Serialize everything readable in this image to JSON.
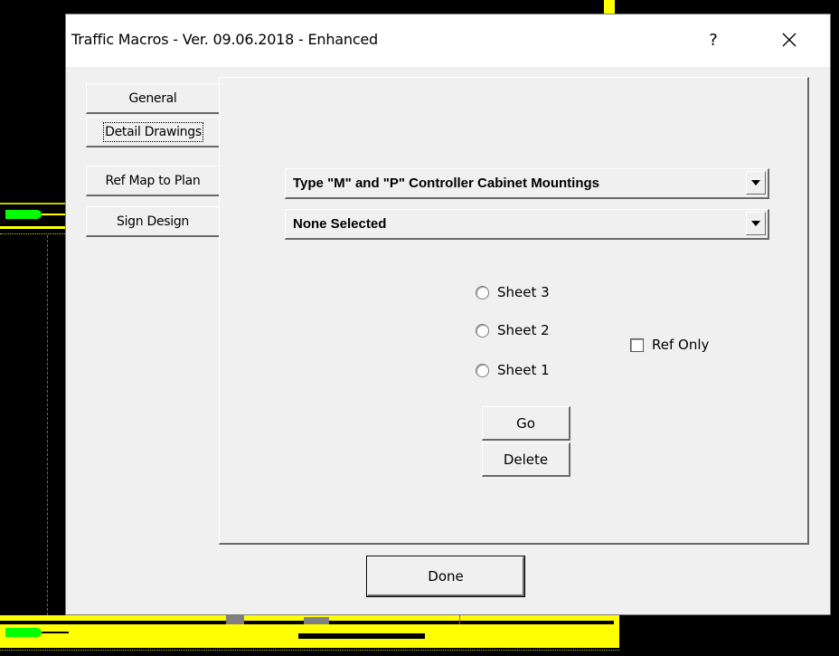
{
  "window": {
    "title": "Traffic Macros - Ver. 09.06.2018 - Enhanced",
    "help_label": "?",
    "close_label": "✕"
  },
  "tabs": [
    {
      "label": "General",
      "active": false
    },
    {
      "label": "Detail Drawings",
      "active": true
    },
    {
      "label": "Ref Map to Plan",
      "active": false
    },
    {
      "label": "Sign Design",
      "active": false
    }
  ],
  "detail": {
    "drawing_select": {
      "value": "Type \"M\" and \"P\" Controller Cabinet Mountings"
    },
    "second_select": {
      "value": "None Selected"
    },
    "sheets": [
      {
        "label": "Sheet 3",
        "checked": false
      },
      {
        "label": "Sheet 2",
        "checked": false
      },
      {
        "label": "Sheet 1",
        "checked": false
      }
    ],
    "ref_only": {
      "label": "Ref Only",
      "checked": false
    },
    "go_label": "Go",
    "delete_label": "Delete"
  },
  "footer": {
    "done_label": "Done"
  },
  "colors": {
    "cad_yellow": "#ffff00",
    "cad_green": "#00ff00",
    "cad_magenta": "#ff00ff",
    "dialog_bg": "#f0f0f0"
  }
}
